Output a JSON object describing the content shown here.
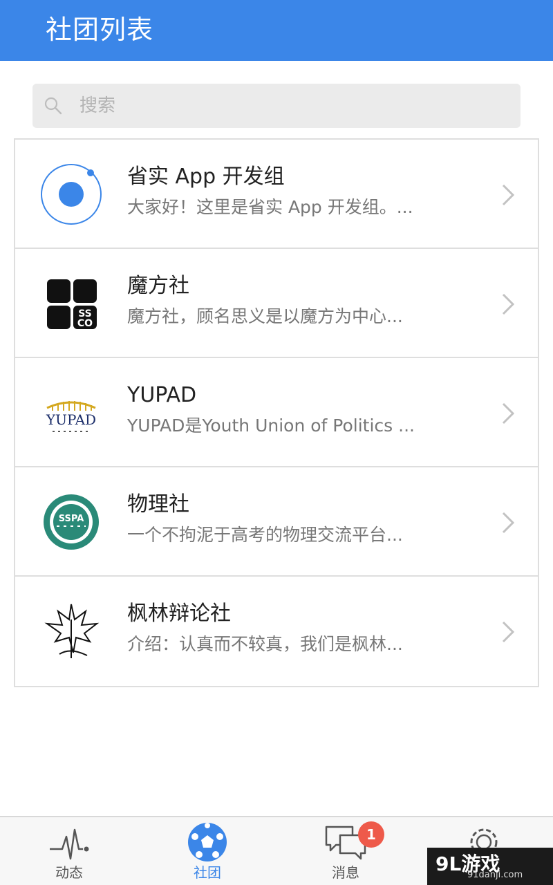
{
  "header": {
    "title": "社团列表"
  },
  "search": {
    "placeholder": "搜索",
    "value": ""
  },
  "clubs": [
    {
      "name": "省实 App 开发组",
      "description": "大家好！这里是省实 App 开发组。...",
      "logo_icon": "blue-circle-icon"
    },
    {
      "name": "魔方社",
      "description": "魔方社，顾名思义是以魔方为中心...",
      "logo_icon": "ssco-cube-logo"
    },
    {
      "name": "YUPAD",
      "description": "YUPAD是Youth Union of Politics ...",
      "logo_icon": "yupad-logo"
    },
    {
      "name": "物理社",
      "description": "一个不拘泥于高考的物理交流平台...",
      "logo_icon": "sspa-seal-logo"
    },
    {
      "name": "枫林辩论社",
      "description": "介绍：认真而不较真，我们是枫林...",
      "logo_icon": "maple-leaf-logo"
    }
  ],
  "tabs": [
    {
      "label": "动态",
      "icon": "pulse-icon",
      "active": false
    },
    {
      "label": "社团",
      "icon": "soccer-ball-icon",
      "active": true
    },
    {
      "label": "消息",
      "icon": "chat-bubbles-icon",
      "active": false,
      "badge": "1"
    },
    {
      "label": "",
      "icon": "gear-icon",
      "active": false
    }
  ],
  "watermark": {
    "logo": "9L游戏",
    "url": "91danji.com"
  },
  "colors": {
    "accent": "#3b86e8",
    "badge": "#ee5a4a",
    "divider": "#dedede",
    "sspa_green": "#2a8a78"
  }
}
